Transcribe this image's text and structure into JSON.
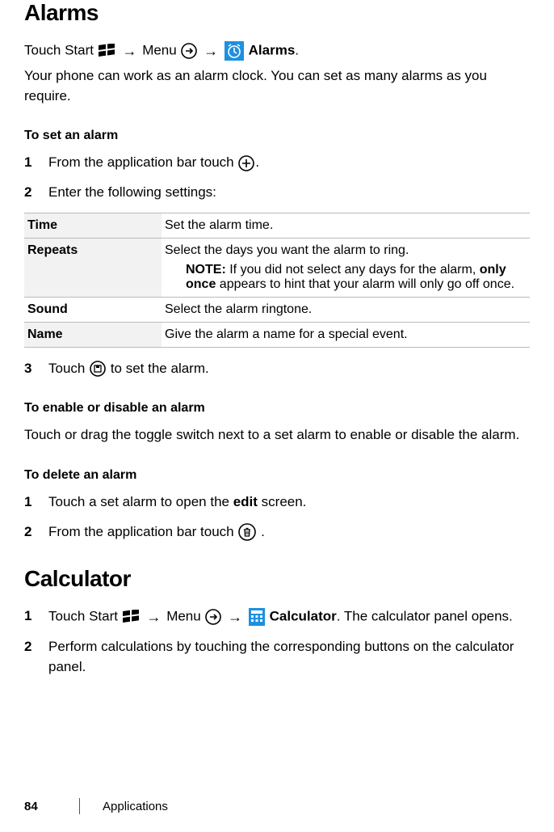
{
  "alarms": {
    "title": "Alarms",
    "nav_touch_start": "Touch Start ",
    "nav_menu": " Menu ",
    "nav_alarms_label": " Alarms",
    "nav_period": ".",
    "intro": "Your phone can work as an alarm clock. You can set as many alarms as you require.",
    "set_head": "To set an alarm",
    "step1_num": "1",
    "step1_a": "From the application bar touch ",
    "step1_b": ".",
    "step2_num": "2",
    "step2": "Enter the following settings:",
    "table": {
      "time_key": "Time",
      "time_val": "Set the alarm time.",
      "repeats_key": "Repeats",
      "repeats_val": "Select the days you want the alarm to ring.",
      "repeats_note_label": "NOTE:",
      "repeats_note_a": " If you did not select any days for the alarm, ",
      "repeats_note_bold": "only once",
      "repeats_note_b": " appears to hint that your alarm will only go off once.",
      "sound_key": "Sound",
      "sound_val": "Select the alarm ringtone.",
      "name_key": "Name",
      "name_val": "Give the alarm a name for a special event."
    },
    "step3_num": "3",
    "step3_a": "Touch ",
    "step3_b": " to set the alarm.",
    "enable_head": "To enable or disable an alarm",
    "enable_body": "Touch or drag the toggle switch next to a set alarm to enable or disable the alarm.",
    "delete_head": "To delete an alarm",
    "del1_num": "1",
    "del1_a": "Touch a set alarm to open the ",
    "del1_bold": "edit",
    "del1_b": " screen.",
    "del2_num": "2",
    "del2_a": "From the application bar touch ",
    "del2_b": "."
  },
  "calculator": {
    "title": "Calculator",
    "c1_num": "1",
    "c1_touch_start": "Touch Start ",
    "c1_menu": " Menu ",
    "c1_calc_label": " Calculator",
    "c1_after": ". The calculator panel opens.",
    "c2_num": "2",
    "c2": "Perform calculations by touching the corresponding buttons on the calculator panel."
  },
  "footer": {
    "page_num": "84",
    "section": "Applications"
  },
  "arrows": {
    "r": "→"
  }
}
